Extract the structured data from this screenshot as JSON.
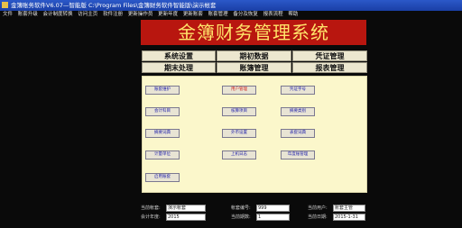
{
  "window": {
    "title": "金簿账务软件V6.07—智能版    C:\\Program Files\\金簿财务软件智能版\\演示帐套"
  },
  "menu": [
    "文件",
    "账套升级",
    "会计制度转换",
    "访问主页",
    "软件注册",
    "更新操作员",
    "更新年度",
    "更新账套",
    "账套管理",
    "备分及恢复",
    "报表流程",
    "帮助"
  ],
  "banner": {
    "title": "金簿财务管理系统"
  },
  "tabs": {
    "row1": [
      "系统设置",
      "期初数据",
      "凭证管理"
    ],
    "row2": [
      "期末处理",
      "账簿管理",
      "报表管理"
    ]
  },
  "buttons": {
    "b1": "账套维护",
    "b2": "用户管理",
    "b3": "凭证字号",
    "b4": "会计科目",
    "b5": "核算项目",
    "b6": "摘要类别",
    "b7": "摘要词典",
    "b8": "外币设置",
    "b9": "表套词典",
    "b10": "计量单位",
    "b11": "上机日志",
    "b12": "年度账管理",
    "b13": "启用账套"
  },
  "status": {
    "account_set_label": "当前帐套:",
    "account_set_value": "演示帐套",
    "account_no_label": "帐套编号:",
    "account_no_value": "999",
    "user_label": "当前用户:",
    "user_value": "账套主管",
    "fiscal_year_label": "会计年度:",
    "fiscal_year_value": "2015",
    "period_label": "当前期数:",
    "period_value": "1",
    "date_label": "当前日期:",
    "date_value": "2015-1-31"
  },
  "colors": {
    "banner_bg": "#b8160f",
    "banner_text": "#ffe46a",
    "panel_bg": "#fbf7cb",
    "highlight_text": "#d0201a"
  }
}
